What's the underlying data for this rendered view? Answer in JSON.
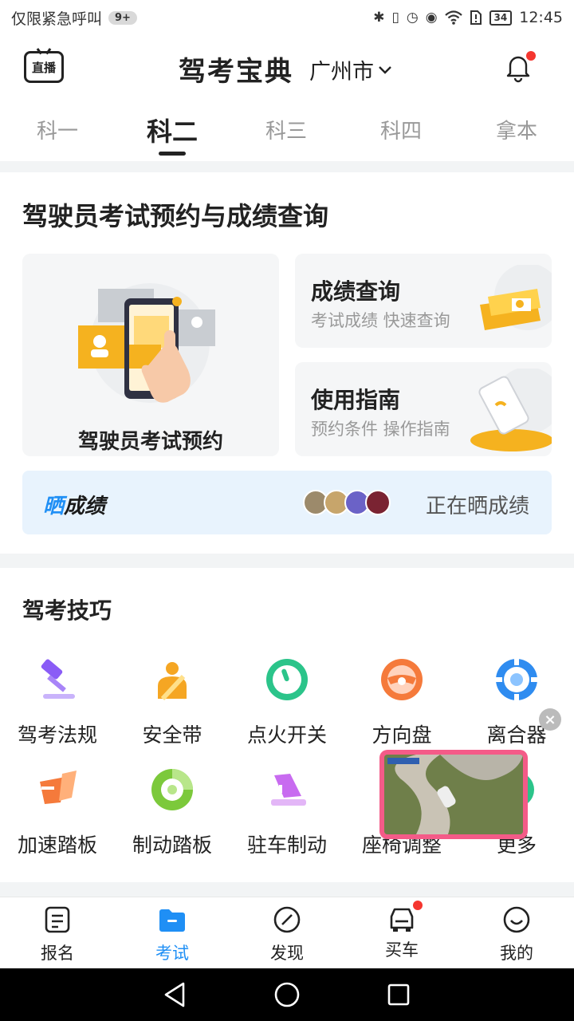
{
  "status_bar": {
    "carrier": "仅限紧急呼叫",
    "badge": "9+",
    "battery": "34",
    "time": "12:45",
    "icons": [
      "bluetooth-icon",
      "vibrate-icon",
      "alarm-icon",
      "eye-icon",
      "wifi-icon",
      "sim-alert-icon",
      "battery-icon"
    ]
  },
  "header": {
    "live_label": "直播",
    "title": "驾考宝典",
    "city": "广州市"
  },
  "tabs": [
    {
      "label": "科一"
    },
    {
      "label": "科二",
      "active": true
    },
    {
      "label": "科三"
    },
    {
      "label": "科四"
    },
    {
      "label": "拿本"
    }
  ],
  "booking": {
    "title": "驾驶员考试预约与成绩查询",
    "main_card": "驾驶员考试预约",
    "score": {
      "title": "成绩查询",
      "subtitle": "考试成绩 快速查询"
    },
    "guide": {
      "title": "使用指南",
      "subtitle": "预约条件 操作指南"
    }
  },
  "share": {
    "logo_blue": "晒",
    "logo_dark": "成绩",
    "text": "正在晒成绩"
  },
  "skills": {
    "title": "驾考技巧",
    "items": [
      {
        "label": "驾考法规",
        "icon": "gavel-icon",
        "color": "#8a5cf6"
      },
      {
        "label": "安全带",
        "icon": "seatbelt-icon",
        "color": "#f5a623"
      },
      {
        "label": "点火开关",
        "icon": "ignition-icon",
        "color": "#2bc48a"
      },
      {
        "label": "方向盘",
        "icon": "steering-wheel-icon",
        "color": "#f57a3b"
      },
      {
        "label": "离合器",
        "icon": "clutch-icon",
        "color": "#2f8cf0"
      },
      {
        "label": "加速踏板",
        "icon": "accelerator-icon",
        "color": "#f57a3b"
      },
      {
        "label": "制动踏板",
        "icon": "brake-icon",
        "color": "#7cc93b"
      },
      {
        "label": "驻车制动",
        "icon": "parking-brake-icon",
        "color": "#c86bf0"
      },
      {
        "label": "座椅调整",
        "icon": "seat-icon",
        "color": "#f5a623"
      },
      {
        "label": "更多",
        "icon": "more-icon",
        "color": "#2bc48a"
      }
    ]
  },
  "bottom_nav": [
    {
      "label": "报名",
      "icon": "register-icon"
    },
    {
      "label": "考试",
      "icon": "exam-icon",
      "active": true
    },
    {
      "label": "发现",
      "icon": "discover-icon"
    },
    {
      "label": "买车",
      "icon": "car-icon",
      "dot": true
    },
    {
      "label": "我的",
      "icon": "profile-icon"
    }
  ],
  "colors": {
    "accent": "#1f8ff5",
    "notification": "#f5362f"
  }
}
